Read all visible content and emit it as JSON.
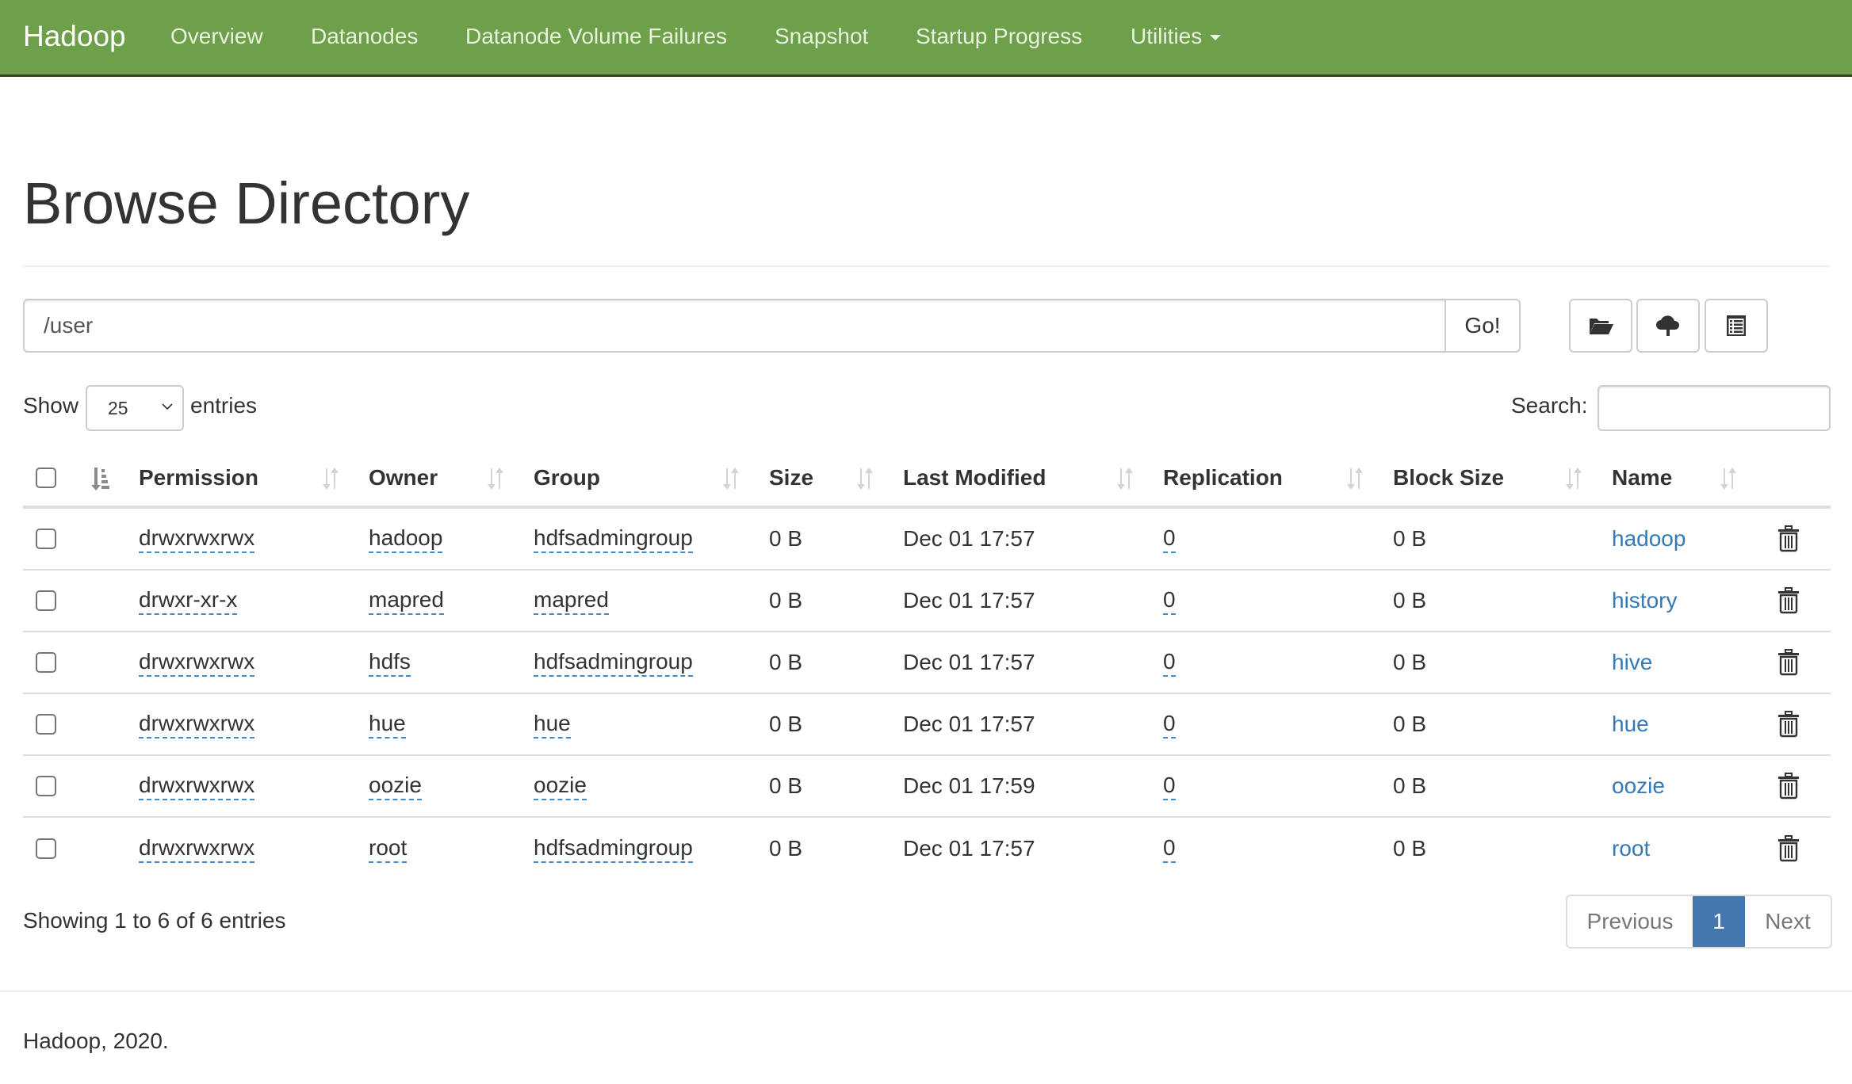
{
  "navbar": {
    "brand": "Hadoop",
    "items": [
      {
        "label": "Overview"
      },
      {
        "label": "Datanodes"
      },
      {
        "label": "Datanode Volume Failures"
      },
      {
        "label": "Snapshot"
      },
      {
        "label": "Startup Progress"
      },
      {
        "label": "Utilities",
        "dropdown": true
      }
    ],
    "color": "#6ea04c"
  },
  "page": {
    "title": "Browse Directory"
  },
  "path_bar": {
    "value": "/user",
    "go_label": "Go!",
    "actions": [
      {
        "icon": "folder-open-icon",
        "name": "create-directory-button"
      },
      {
        "icon": "cloud-upload-icon",
        "name": "upload-button"
      },
      {
        "icon": "list-icon",
        "name": "cut-paste-list-button"
      }
    ]
  },
  "controls": {
    "show_label": "Show",
    "entries_value": "25",
    "entries_label": "entries",
    "search_label": "Search:",
    "search_value": ""
  },
  "table": {
    "columns": [
      "Permission",
      "Owner",
      "Group",
      "Size",
      "Last Modified",
      "Replication",
      "Block Size",
      "Name"
    ],
    "sorted_column": "Permission",
    "rows": [
      {
        "permission": "drwxrwxrwx",
        "owner": "hadoop",
        "group": "hdfsadmingroup",
        "size": "0 B",
        "modified": "Dec 01 17:57",
        "replication": "0",
        "block_size": "0 B",
        "name": "hadoop"
      },
      {
        "permission": "drwxr-xr-x",
        "owner": "mapred",
        "group": "mapred",
        "size": "0 B",
        "modified": "Dec 01 17:57",
        "replication": "0",
        "block_size": "0 B",
        "name": "history"
      },
      {
        "permission": "drwxrwxrwx",
        "owner": "hdfs",
        "group": "hdfsadmingroup",
        "size": "0 B",
        "modified": "Dec 01 17:57",
        "replication": "0",
        "block_size": "0 B",
        "name": "hive"
      },
      {
        "permission": "drwxrwxrwx",
        "owner": "hue",
        "group": "hue",
        "size": "0 B",
        "modified": "Dec 01 17:57",
        "replication": "0",
        "block_size": "0 B",
        "name": "hue"
      },
      {
        "permission": "drwxrwxrwx",
        "owner": "oozie",
        "group": "oozie",
        "size": "0 B",
        "modified": "Dec 01 17:59",
        "replication": "0",
        "block_size": "0 B",
        "name": "oozie"
      },
      {
        "permission": "drwxrwxrwx",
        "owner": "root",
        "group": "hdfsadmingroup",
        "size": "0 B",
        "modified": "Dec 01 17:57",
        "replication": "0",
        "block_size": "0 B",
        "name": "root"
      }
    ]
  },
  "summary": {
    "info": "Showing 1 to 6 of 6 entries"
  },
  "pagination": {
    "previous": "Previous",
    "current": "1",
    "next": "Next",
    "active_color": "#4678b0"
  },
  "footer": {
    "text": "Hadoop, 2020."
  }
}
